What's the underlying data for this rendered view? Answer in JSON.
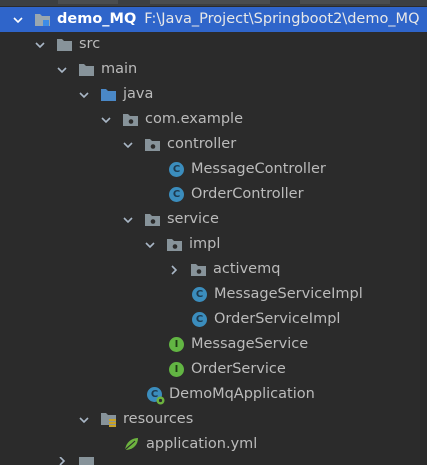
{
  "project": {
    "name": "demo_MQ",
    "path": "F:\\Java_Project\\Springboot2\\demo_MQ"
  },
  "colors": {
    "background": "#2b2b2b",
    "selection": "#2f65ca",
    "folder": "#87939a",
    "source_root": "#4a88c7",
    "class_icon": "#3b8dbd",
    "interface_icon": "#62b543",
    "spring": "#6db33f"
  },
  "tree": {
    "src": "src",
    "main": "main",
    "java": "java",
    "package_root": "com.example",
    "controller": "controller",
    "controller_classes": [
      "MessageController",
      "OrderController"
    ],
    "service": "service",
    "impl": "impl",
    "activemq": "activemq",
    "impl_classes": [
      "MessageServiceImpl",
      "OrderServiceImpl"
    ],
    "service_interfaces": [
      "MessageService",
      "OrderService"
    ],
    "app_class": "DemoMqApplication",
    "resources": "resources",
    "config_file": "application.yml"
  },
  "icons": {
    "class_letter": "C",
    "interface_letter": "I"
  }
}
